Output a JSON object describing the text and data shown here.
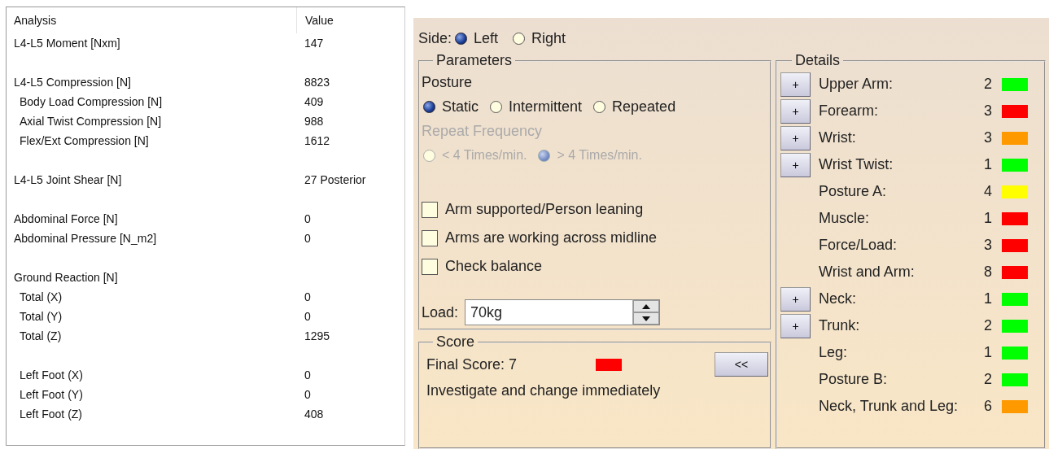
{
  "analysis_table": {
    "columns": [
      "Analysis",
      "Value"
    ],
    "rows": [
      {
        "label": "L4-L5 Moment [Nxm]",
        "value": "147"
      },
      {
        "label": "L4-L5 Compression [N]",
        "value": "8823",
        "gap_before": true,
        "children": [
          {
            "label": "Body Load Compression [N]",
            "value": "409"
          },
          {
            "label": "Axial Twist Compression [N]",
            "value": "988"
          },
          {
            "label": "Flex/Ext Compression [N]",
            "value": "1612"
          }
        ]
      },
      {
        "label": "L4-L5 Joint Shear [N]",
        "value": "27  Posterior",
        "gap_before": true
      },
      {
        "label": "Abdominal Force [N]",
        "value": "0",
        "gap_before": true
      },
      {
        "label": "Abdominal Pressure [N_m2]",
        "value": "0"
      },
      {
        "label": "Ground Reaction [N]",
        "gap_before": true,
        "children": [
          {
            "label": "Total (X)",
            "value": "0"
          },
          {
            "label": "Total (Y)",
            "value": "0"
          },
          {
            "label": "Total (Z)",
            "value": "1295"
          },
          {
            "label": "Left Foot (X)",
            "value": "0",
            "gap_before": true
          },
          {
            "label": "Left Foot (Y)",
            "value": "0"
          },
          {
            "label": "Left Foot (Z)",
            "value": "408"
          }
        ]
      }
    ]
  },
  "side": {
    "label": "Side:",
    "options": [
      {
        "label": "Left",
        "selected": true
      },
      {
        "label": "Right",
        "selected": false
      }
    ]
  },
  "parameters": {
    "title": "Parameters",
    "posture": {
      "label": "Posture",
      "options": [
        {
          "label": "Static",
          "selected": true
        },
        {
          "label": "Intermittent",
          "selected": false
        },
        {
          "label": "Repeated",
          "selected": false
        }
      ]
    },
    "repeat_frequency": {
      "label": "Repeat Frequency",
      "disabled": true,
      "options": [
        {
          "label": "< 4 Times/min.",
          "selected": false
        },
        {
          "label": "> 4 Times/min.",
          "selected": true
        }
      ]
    },
    "checkboxes": [
      {
        "label": "Arm supported/Person leaning",
        "checked": false
      },
      {
        "label": "Arms are working across midline",
        "checked": false
      },
      {
        "label": "Check balance",
        "checked": false
      }
    ],
    "load": {
      "label": "Load:",
      "value": "70kg"
    }
  },
  "score": {
    "title": "Score",
    "final_label": "Final Score: 7",
    "color": "#ff0000",
    "message": "Investigate and change immediately",
    "button": "<<"
  },
  "details": {
    "title": "Details",
    "rows": [
      {
        "expand_button": "+",
        "label": "Upper Arm:",
        "value": "2",
        "color": "#00ff00"
      },
      {
        "expand_button": "+",
        "label": "Forearm:",
        "value": "3",
        "color": "#ff0000"
      },
      {
        "expand_button": "+",
        "label": "Wrist:",
        "value": "3",
        "color": "#ff9900"
      },
      {
        "expand_button": "+",
        "label": "Wrist Twist:",
        "value": "1",
        "color": "#00ff00"
      },
      {
        "label": "Posture A:",
        "value": "4",
        "color": "#ffff00"
      },
      {
        "label": "Muscle:",
        "value": "1",
        "color": "#ff0000"
      },
      {
        "label": "Force/Load:",
        "value": "3",
        "color": "#ff0000"
      },
      {
        "label": "Wrist and Arm:",
        "value": "8",
        "color": "#ff0000"
      },
      {
        "expand_button": "+",
        "label": "Neck:",
        "value": "1",
        "color": "#00ff00"
      },
      {
        "expand_button": "+",
        "label": "Trunk:",
        "value": "2",
        "color": "#00ff00"
      },
      {
        "label": "Leg:",
        "value": "1",
        "color": "#00ff00"
      },
      {
        "label": "Posture B:",
        "value": "2",
        "color": "#00ff00"
      },
      {
        "label": "Neck, Trunk and Leg:",
        "value": "6",
        "color": "#ff9900"
      }
    ]
  }
}
